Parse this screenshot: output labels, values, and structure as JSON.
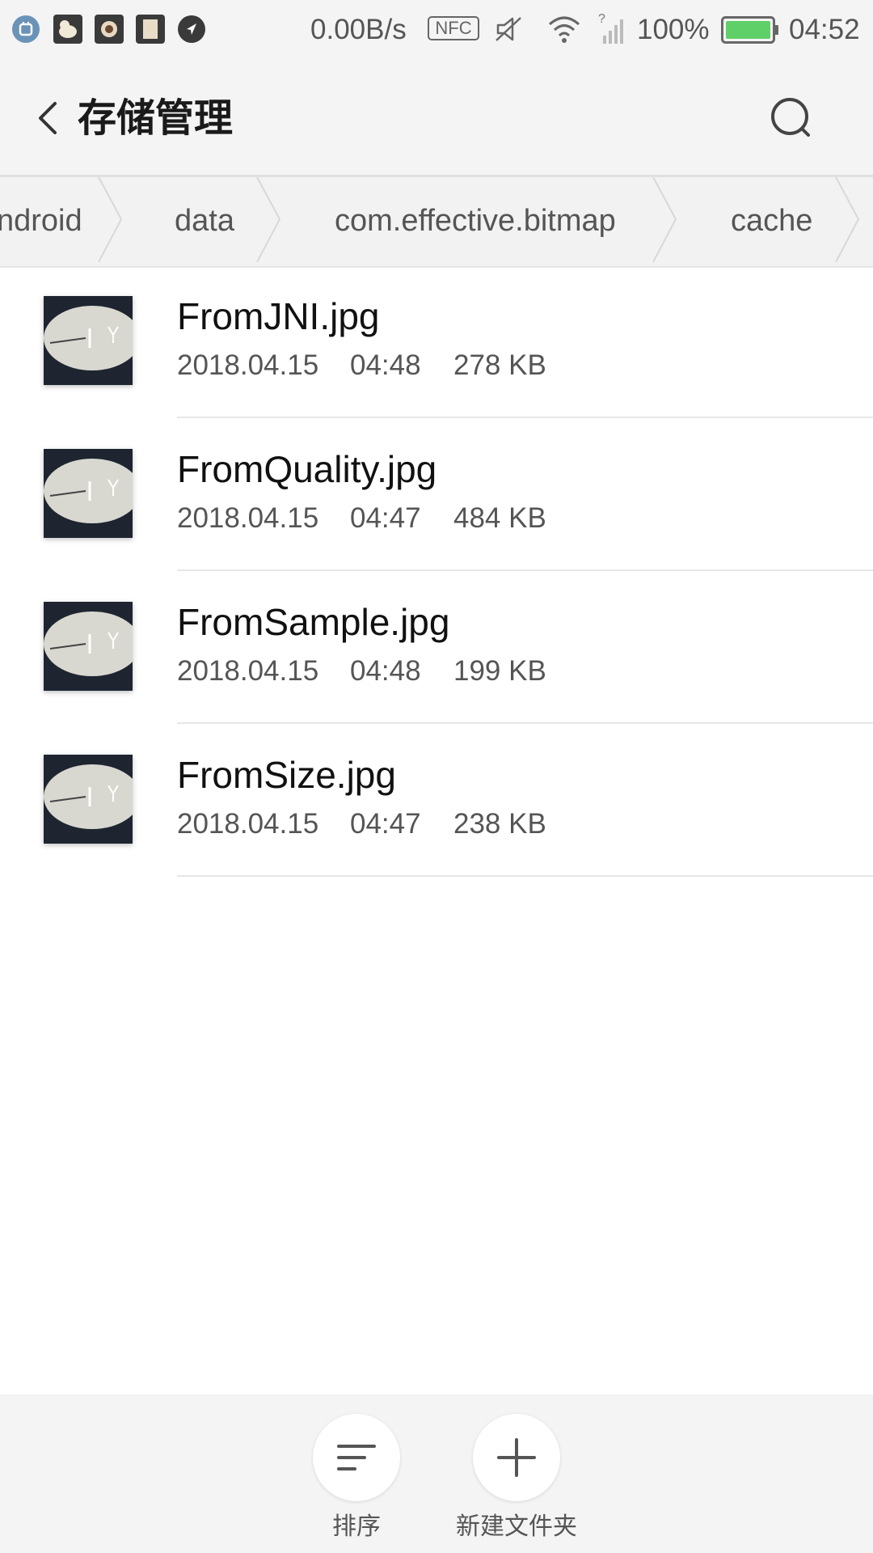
{
  "status_bar": {
    "net_speed": "0.00B/s",
    "nfc_label": "NFC",
    "battery": "100%",
    "time": "04:52",
    "notification_icons": [
      "app-icon",
      "duck-icon",
      "camera-icon",
      "note-icon",
      "navigation-icon"
    ]
  },
  "header": {
    "title": "存储管理",
    "back_icon": "back-arrow-icon",
    "search_icon": "search-icon"
  },
  "breadcrumb": [
    "ndroid",
    "data",
    "com.effective.bitmap",
    "cache"
  ],
  "files": [
    {
      "name": "FromJNI.jpg",
      "date": "2018.04.15",
      "time": "04:48",
      "size": "278 KB"
    },
    {
      "name": "FromQuality.jpg",
      "date": "2018.04.15",
      "time": "04:47",
      "size": "484 KB"
    },
    {
      "name": "FromSample.jpg",
      "date": "2018.04.15",
      "time": "04:48",
      "size": "199 KB"
    },
    {
      "name": "FromSize.jpg",
      "date": "2018.04.15",
      "time": "04:47",
      "size": "238 KB"
    }
  ],
  "toolbar": {
    "sort_label": "排序",
    "new_folder_label": "新建文件夹"
  },
  "colors": {
    "bar_background": "#f4f4f4",
    "battery_fill": "#5fd068",
    "text_secondary": "#555555"
  }
}
